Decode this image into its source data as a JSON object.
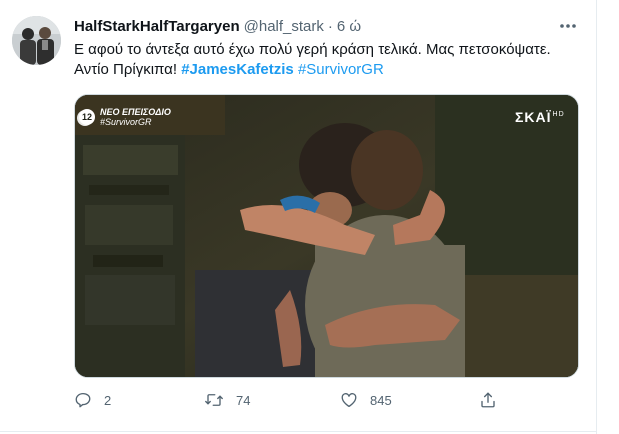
{
  "tweet": {
    "display_name": "HalfStarkHalfTargaryen",
    "handle": "@half_stark",
    "separator": "·",
    "time": "6 ώ",
    "text_line1": "Ε αφού το άντεξα αυτό έχω πολύ γερή κράση τελικά. Μας πετσοκόψατε.",
    "text_line2_prefix": "Αντίο Πρίγκιπα! ",
    "hashtag1": "#JamesKafetzis",
    "hashtag2": "#SurvivorGR"
  },
  "media": {
    "overlay_badge": "12",
    "overlay_line1": "ΝΕΟ ΕΠΕΙΣΟΔΙΟ",
    "overlay_line2": "#SurvivorGR",
    "channel_logo": "ΣΚΑΪ",
    "channel_hd": "HD"
  },
  "actions": {
    "reply_count": "2",
    "retweet_count": "74",
    "like_count": "845",
    "reply_icon": "reply-icon",
    "retweet_icon": "retweet-icon",
    "like_icon": "heart-icon",
    "share_icon": "share-icon"
  },
  "colors": {
    "accent": "#1d9bf0",
    "secondary_text": "#536471",
    "primary_text": "#0f1419"
  }
}
